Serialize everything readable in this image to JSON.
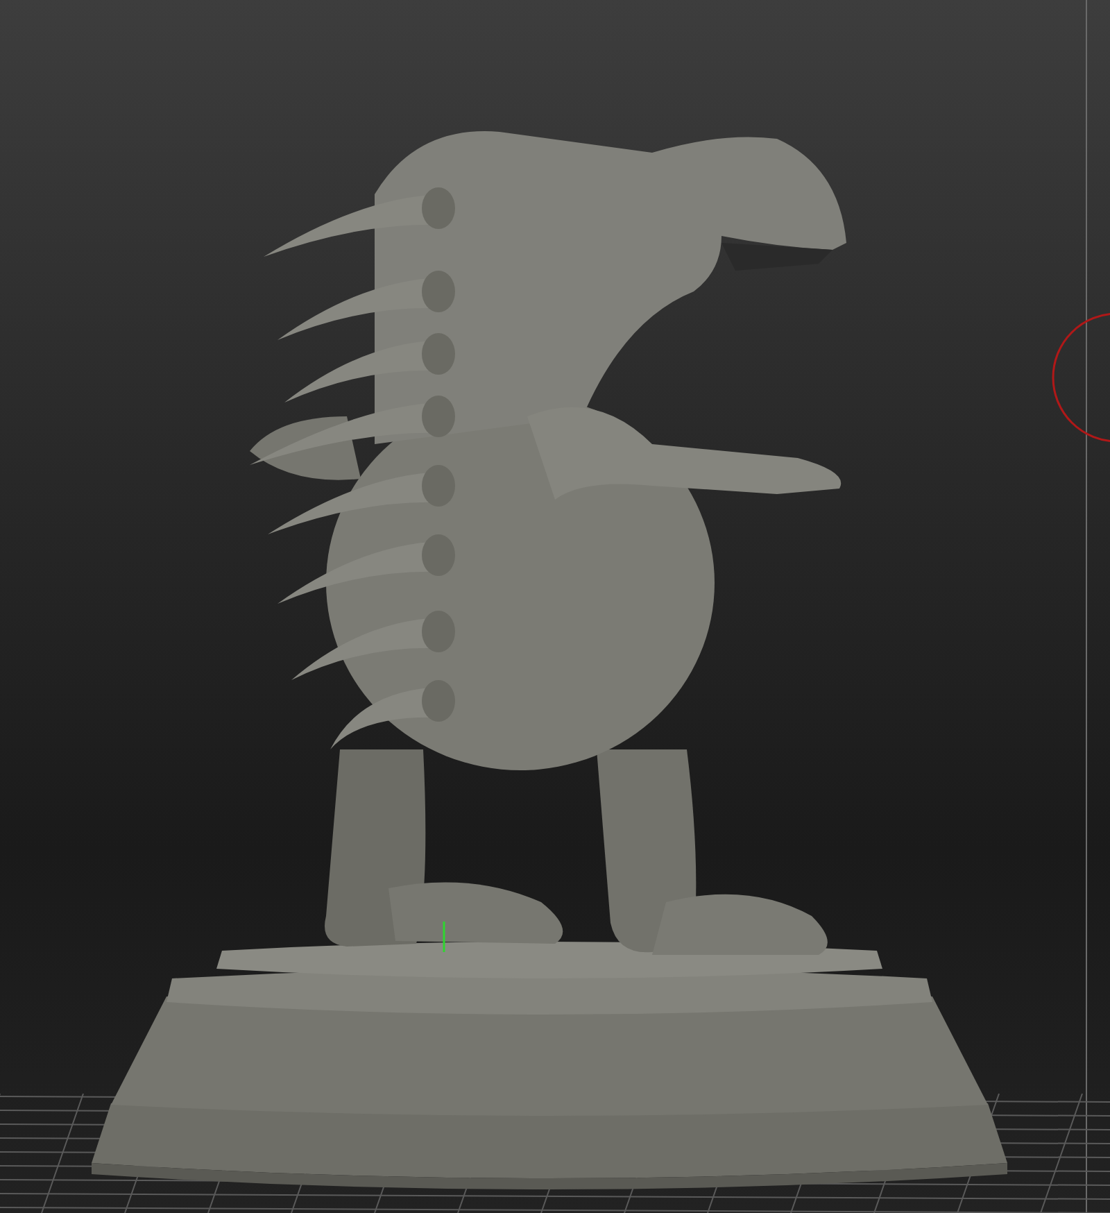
{
  "viewport": {
    "floor_grid": true,
    "brush_cursor": true
  }
}
